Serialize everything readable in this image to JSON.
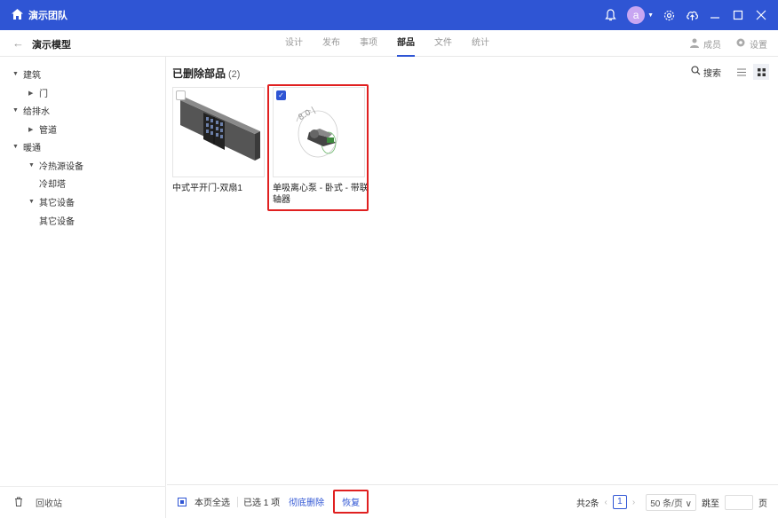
{
  "titlebar": {
    "team": "演示团队",
    "avatar_letter": "a",
    "colors": {
      "bar": "#2f55d4",
      "avatar": "#c8a6f2"
    }
  },
  "subheader": {
    "model_title": "演示模型",
    "tabs": [
      "设计",
      "发布",
      "事项",
      "部品",
      "文件",
      "统计"
    ],
    "active_tab": "部品",
    "members_label": "成员",
    "settings_label": "设置"
  },
  "tree": [
    {
      "label": "建筑"
    },
    {
      "label": "门"
    },
    {
      "label": "给排水"
    },
    {
      "label": "管道"
    },
    {
      "label": "暖通"
    },
    {
      "label": "冷热源设备"
    },
    {
      "label": "冷却塔"
    },
    {
      "label": "其它设备"
    },
    {
      "label": "其它设备"
    }
  ],
  "recycle_label": "回收站",
  "main": {
    "title": "已删除部品",
    "count": "(2)",
    "search_label": "搜索",
    "cards": [
      {
        "name": "中式平开门-双扇1",
        "checked": false
      },
      {
        "name": "单吸离心泵 - 卧式 - 带联轴器",
        "checked": true
      }
    ]
  },
  "footer": {
    "select_all": "本页全选",
    "selected": "已选 1 项",
    "delete_perm": "彻底删除",
    "restore": "恢复",
    "total": "共2条",
    "page": "1",
    "page_size": "50 条/页",
    "goto": "跳至",
    "page_unit": "页"
  }
}
